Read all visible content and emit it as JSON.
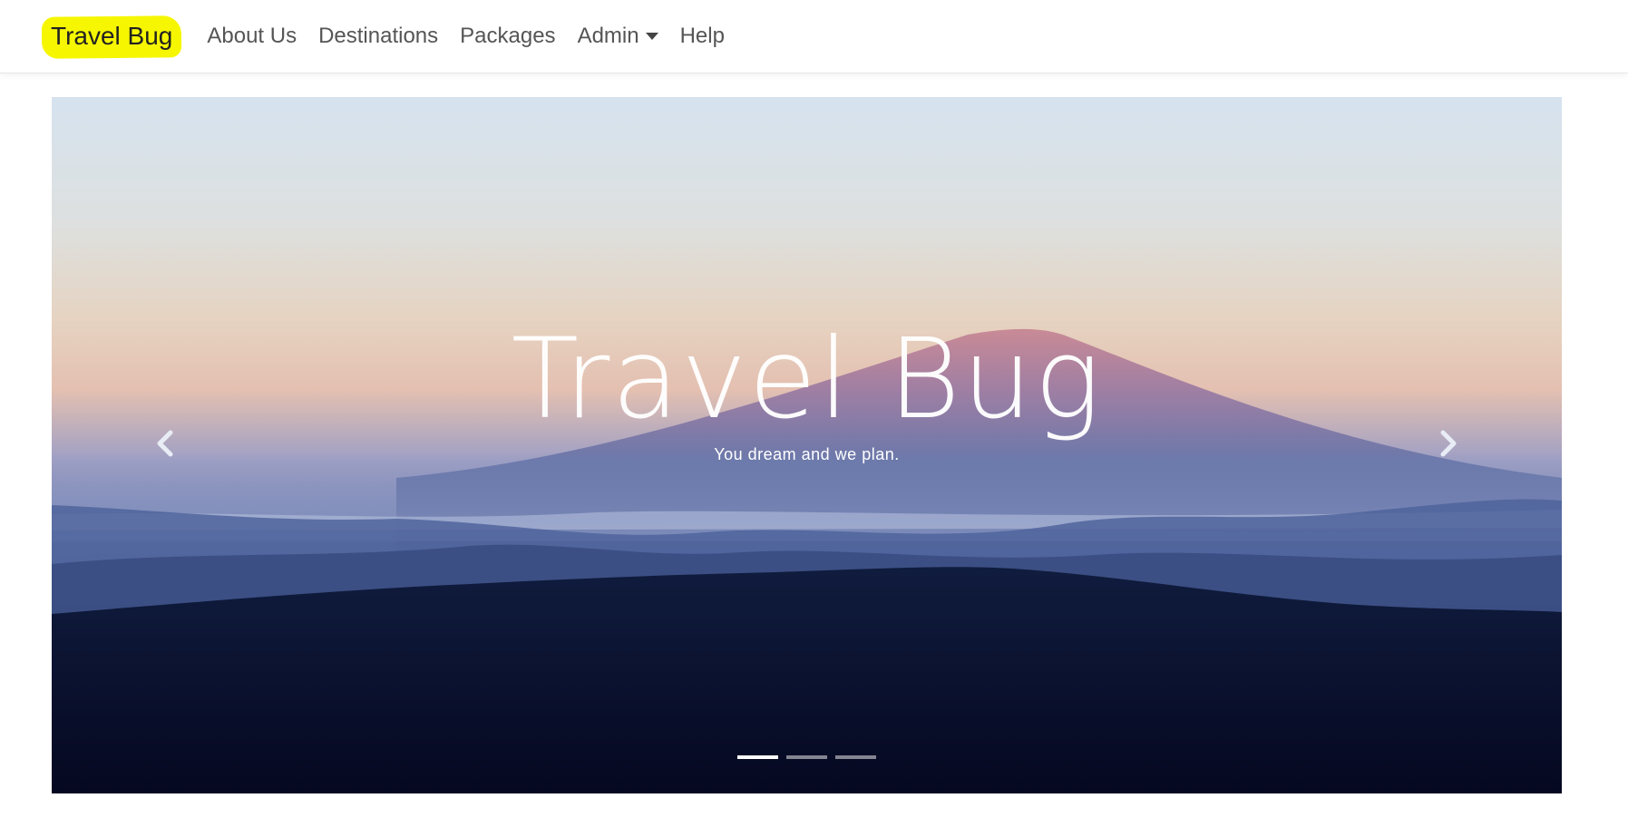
{
  "navbar": {
    "brand": "Travel Bug",
    "links": [
      {
        "label": "About Us"
      },
      {
        "label": "Destinations"
      },
      {
        "label": "Packages"
      },
      {
        "label": "Admin",
        "dropdown": true
      },
      {
        "label": "Help"
      }
    ],
    "brand_highlight_color": "#f6f600"
  },
  "carousel": {
    "title": "Travel Bug",
    "subtitle": "You dream and we plan.",
    "prev_icon": "chevron-left-icon",
    "next_icon": "chevron-right-icon",
    "slide_count": 3,
    "active_slide": 1,
    "image": "mountain-sunrise-landscape"
  }
}
